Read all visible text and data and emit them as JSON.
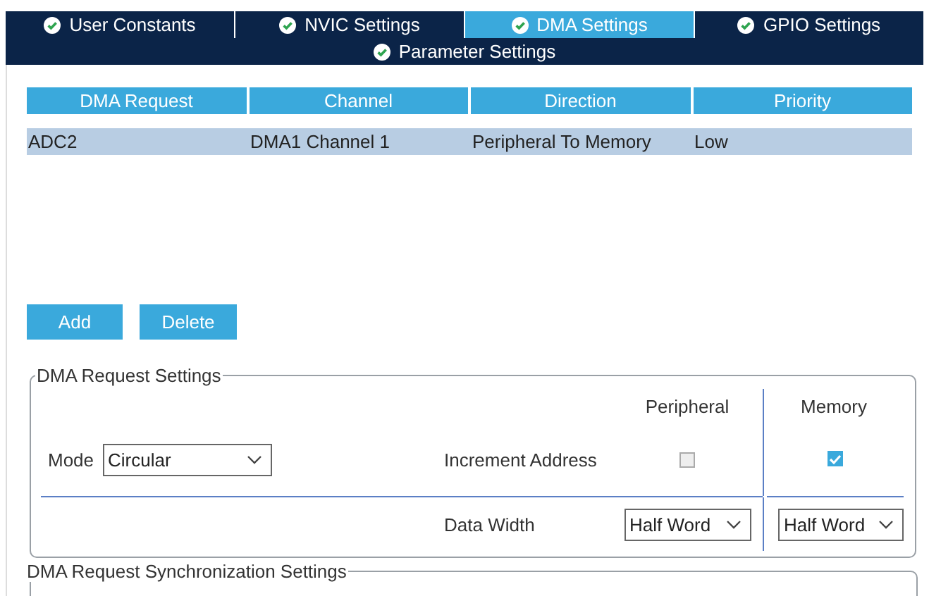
{
  "tabs": [
    {
      "label": "User Constants",
      "selected": false
    },
    {
      "label": "NVIC Settings",
      "selected": false
    },
    {
      "label": "DMA Settings",
      "selected": true
    },
    {
      "label": "GPIO Settings",
      "selected": false
    }
  ],
  "subtabs": [
    {
      "label": "Parameter Settings",
      "selected": false
    }
  ],
  "table": {
    "columns": [
      "DMA Request",
      "Channel",
      "Direction",
      "Priority"
    ],
    "rows": [
      {
        "cells": [
          "ADC2",
          "DMA1 Channel 1",
          "Peripheral To Memory",
          "Low"
        ],
        "selected": true
      }
    ]
  },
  "buttons": [
    "Add",
    "Delete"
  ],
  "request_settings": {
    "legend": "DMA Request Settings",
    "mode_label": "Mode",
    "mode_value": "Circular",
    "peripheral_header": "Peripheral",
    "memory_header": "Memory",
    "increment_label": "Increment Address",
    "peripheral_increment": false,
    "memory_increment": true,
    "data_width_label": "Data Width",
    "peripheral_width": "Half Word",
    "memory_width": "Half Word"
  },
  "sync_settings": {
    "legend": "DMA Request Synchronization Settings"
  }
}
